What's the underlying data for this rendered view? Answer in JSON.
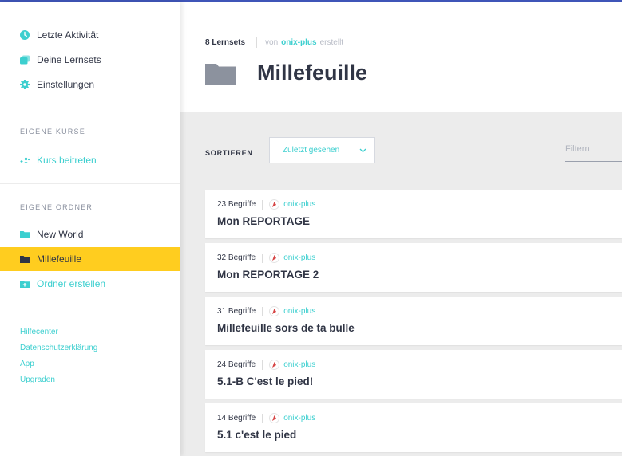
{
  "colors": {
    "accent": "#3ccfcf",
    "active": "#ffcd1f",
    "text": "#303545",
    "muted": "#8c92a0",
    "bg": "#ececec",
    "folder": "#8c929e"
  },
  "sidebar": {
    "main_items": [
      {
        "label": "Letzte Aktivität",
        "icon": "clock-icon"
      },
      {
        "label": "Deine Lernsets",
        "icon": "cards-icon"
      },
      {
        "label": "Einstellungen",
        "icon": "gear-icon"
      }
    ],
    "courses_title": "EIGENE KURSE",
    "join_course": "Kurs beitreten",
    "folders_title": "EIGENE ORDNER",
    "folders": [
      {
        "label": "New World",
        "active": false
      },
      {
        "label": "Millefeuille",
        "active": true
      }
    ],
    "create_folder": "Ordner erstellen",
    "footer": [
      "Hilfecenter",
      "Datenschutzerklärung",
      "App",
      "Upgraden"
    ]
  },
  "header": {
    "count": "8 Lernsets",
    "by_prefix": "von",
    "user": "onix-plus",
    "by_suffix": "erstellt",
    "title": "Millefeuille"
  },
  "toolbar": {
    "sort_label": "SORTIEREN",
    "sort_value": "Zuletzt gesehen",
    "filter_placeholder": "Filtern"
  },
  "sets": [
    {
      "terms": "23 Begriffe",
      "user": "onix-plus",
      "title": "Mon REPORTAGE"
    },
    {
      "terms": "32 Begriffe",
      "user": "onix-plus",
      "title": "Mon REPORTAGE 2"
    },
    {
      "terms": "31 Begriffe",
      "user": "onix-plus",
      "title": "Millefeuille sors de ta bulle"
    },
    {
      "terms": "24 Begriffe",
      "user": "onix-plus",
      "title": "5.1-B C'est le pied!"
    },
    {
      "terms": "14 Begriffe",
      "user": "onix-plus",
      "title": "5.1 c'est le pied"
    }
  ]
}
